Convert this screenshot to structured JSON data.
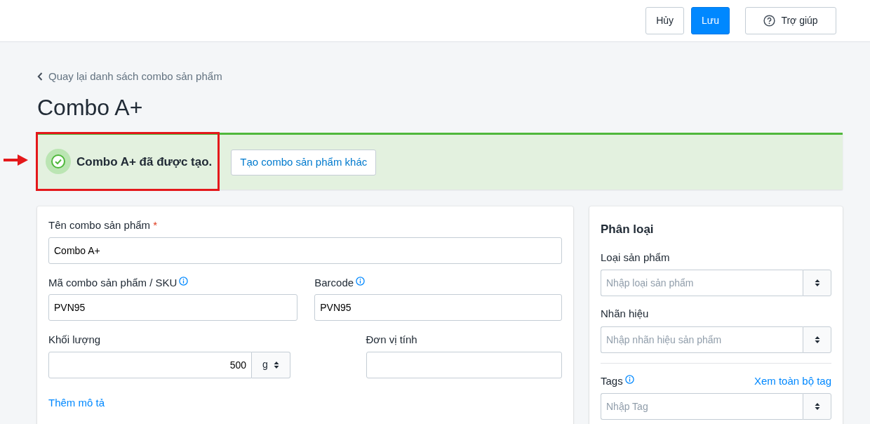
{
  "topbar": {
    "buttons": [
      {
        "label": "Hủy",
        "kind": "outline"
      },
      {
        "label": "Lưu",
        "kind": "primary"
      },
      {
        "label": "Trợ giúp",
        "kind": "help"
      }
    ]
  },
  "back_link": "Quay lại danh sách combo sản phẩm",
  "title": "Combo A+",
  "alert": {
    "message": "Combo A+ đã được tạo.",
    "button": "Tạo combo sản phẩm khác",
    "highlighted": true
  },
  "main_card": {
    "rows": [
      [
        {
          "label": "Tên combo sản phẩm",
          "required_mark": "*",
          "kind": "text",
          "value": "Combo A+"
        }
      ],
      [
        {
          "label": "Mã combo sản phẩm / SKU",
          "info": true,
          "kind": "text",
          "value": "PVN95"
        },
        {
          "label": "Barcode",
          "info": true,
          "kind": "text",
          "value": "PVN95"
        }
      ],
      [
        {
          "label": "Khối lượng",
          "kind": "weight",
          "value": "500",
          "unit": "g"
        },
        {
          "label": "Đơn vị tính",
          "kind": "text"
        }
      ]
    ],
    "link": "Thêm mô tả"
  },
  "side_card": {
    "title": "Phân loại",
    "fields": [
      {
        "label": "Loại sản phẩm",
        "placeholder": "Nhập loại sản phẩm"
      },
      {
        "label": "Nhãn hiệu",
        "placeholder": "Nhập nhãn hiệu sản phẩm"
      },
      {
        "label": "Tags",
        "info": true,
        "placeholder": "Nhập Tag",
        "link": "Xem toàn bộ tag",
        "divider": true
      }
    ]
  }
}
